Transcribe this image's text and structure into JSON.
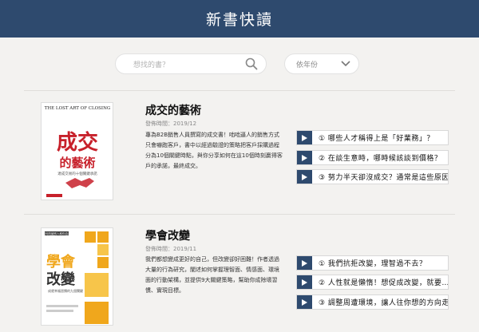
{
  "header": {
    "title": "新書快讀"
  },
  "search": {
    "placeholder": "想找的書？",
    "icon": "search-icon"
  },
  "filter": {
    "selected": "依年份",
    "icon": "chevron-down-icon"
  },
  "books": [
    {
      "title": "成交的藝術",
      "date": "發佈時間：2019/12",
      "description": "專為B2B銷售人員撰寫的成交書！咄咄逼人的銷售方式只會嚇跑客戶，書中以經過驗證的策略把客戶採購過程分為10個關鍵時點，與你分享如何在這10個時刻贏得客戶的承諾，最終成交。",
      "cover": {
        "top": "THE LOST ART OF CLOSING",
        "big1": "成交",
        "big2": "的藝術",
        "sub": "達成交易的十個關鍵承諾",
        "colors": {
          "accent": "#c7202a",
          "bg": "#ffffff"
        }
      },
      "chapters": [
        {
          "label": "① 哪些人才稱得上是「好業務」？"
        },
        {
          "label": "② 在談生意時，哪時候該談到價格？"
        },
        {
          "label": "③ 努力半天卻沒成交？通常是這些原因"
        }
      ]
    },
    {
      "title": "學會改變",
      "date": "發佈時間：2019/11",
      "description": "我們都想變成更好的自己，但改變卻好困難！作者透過大量的行為研究，闡述如何掌握理智面、情感面、環境面的行動架構，並提供9大關鍵策略，幫助你成除壞習慣、實現目標。",
      "cover": {
        "top": "如何改變別人和你自己",
        "big1": "學會",
        "big2": "改變",
        "sub": "成就幸福習慣的九個關鍵",
        "colors": {
          "accent": "#f0a71c",
          "bg": "#ffffff"
        }
      },
      "chapters": [
        {
          "label": "① 我們抗拒改變，理智過不去？"
        },
        {
          "label": "② 人性就是懶惰！想促成改變，就要…"
        },
        {
          "label": "③ 調整周遭環境，讓人往你想的方向走"
        }
      ]
    }
  ],
  "colors": {
    "primary": "#2e4a6e",
    "background": "#f3f2f0"
  }
}
